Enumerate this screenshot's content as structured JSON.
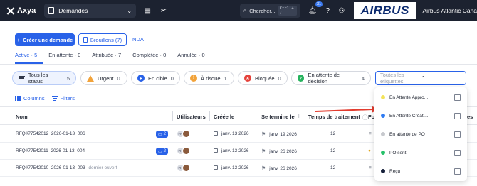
{
  "topbar": {
    "app_name": "Axya",
    "module": "Demandes",
    "search_placeholder": "Chercher...",
    "search_shortcut": "Ctrl + /",
    "notification_count": "31",
    "brand_logo": "AIRBUS",
    "organization": "Airbus Atlantic Cana"
  },
  "actions": {
    "create_label": "Créer une demande",
    "drafts_label": "Brouillons (7)",
    "nda_label": "NDA"
  },
  "tabs": [
    {
      "label": "Active · 5",
      "active": true
    },
    {
      "label": "En attente · 0",
      "active": false
    },
    {
      "label": "Attribuée · 7",
      "active": false
    },
    {
      "label": "Complétée · 0",
      "active": false
    },
    {
      "label": "Annulée · 0",
      "active": false
    }
  ],
  "filters": [
    {
      "label": "Tous les status",
      "count": "5",
      "icon": "filter-lines-icon",
      "color": "#30374a"
    },
    {
      "label": "Urgent",
      "count": "0",
      "icon": "warning-icon",
      "color": "#f2a33a"
    },
    {
      "label": "En cible",
      "count": "0",
      "icon": "play-icon",
      "color": "#2962e8"
    },
    {
      "label": "À risque",
      "count": "1",
      "icon": "exclamation-icon",
      "color": "#f2a33a"
    },
    {
      "label": "Bloquée",
      "count": "0",
      "icon": "close-circle-icon",
      "color": "#e5413a"
    },
    {
      "label": "En attente de décision",
      "count": "4",
      "icon": "check-circle-icon",
      "color": "#27b35e"
    }
  ],
  "tag_filter": {
    "placeholder": "Toutes les étiquettes"
  },
  "toolbar": {
    "columns_label": "Columns",
    "filters_label": "Filters"
  },
  "table": {
    "headers": [
      "Nom",
      "Utilisateurs",
      "Créée le",
      "Se termine le",
      "Temps de traitement",
      "Fou",
      "es"
    ],
    "rows": [
      {
        "name": "RFQ#77542012_2026-01-13_006",
        "note": "",
        "badge": "2",
        "initials": "FH",
        "created": "janv. 13 2026",
        "ends": "janv. 19 2026",
        "time": "12"
      },
      {
        "name": "RFQ#77542011_2026-01-13_004",
        "note": "",
        "badge": "2",
        "initials": "FH",
        "created": "janv. 13 2026",
        "ends": "janv. 26 2026",
        "time": "12"
      },
      {
        "name": "RFQ#77542010_2026-01-13_003",
        "note": "dernier ouvert",
        "badge": "",
        "initials": "FH",
        "created": "janv. 13 2026",
        "ends": "janv. 26 2026",
        "time": "12"
      }
    ]
  },
  "tag_options": [
    {
      "label": "En Attente Appro...",
      "color": "#f3e35a"
    },
    {
      "label": "En Attente Créati...",
      "color": "#2f7bf2"
    },
    {
      "label": "En attente de PO",
      "color": "#c7c9ce"
    },
    {
      "label": "PO sent",
      "color": "#27c16a"
    },
    {
      "label": "Reçu",
      "color": "#16203a"
    }
  ],
  "colors": {
    "accent": "#2962e8",
    "topbar": "#1c2230",
    "arrow": "#e23b2e"
  }
}
